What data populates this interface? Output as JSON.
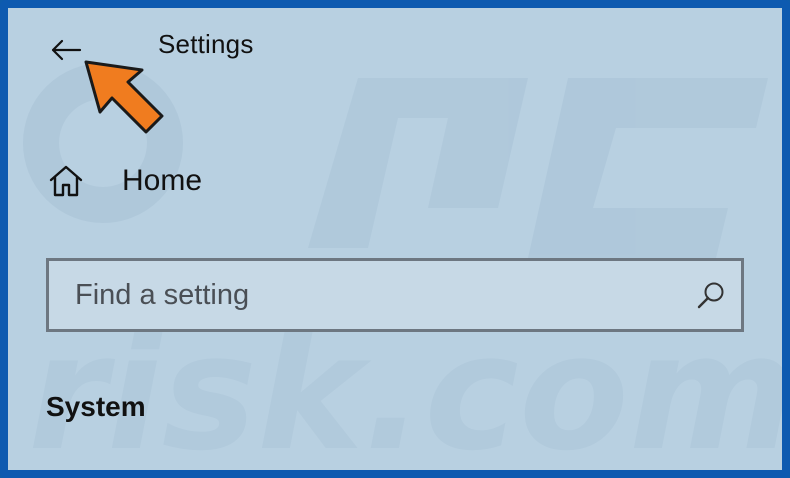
{
  "window": {
    "title": "Settings"
  },
  "nav": {
    "back_icon": "back-arrow-icon",
    "home_icon": "home-icon",
    "home_label": "Home"
  },
  "search": {
    "placeholder": "Find a setting",
    "value": "",
    "icon": "search-icon"
  },
  "section": {
    "title": "System"
  },
  "annotation": {
    "pointer_icon": "orange-pointer-arrow",
    "pointer_color": "#f07c1f"
  },
  "watermark": {
    "text_top": "PC",
    "text_bottom": "risk.com"
  },
  "colors": {
    "background": "#b8d0e1",
    "frame_border": "#0d5ab0",
    "search_border": "#6d7781"
  }
}
